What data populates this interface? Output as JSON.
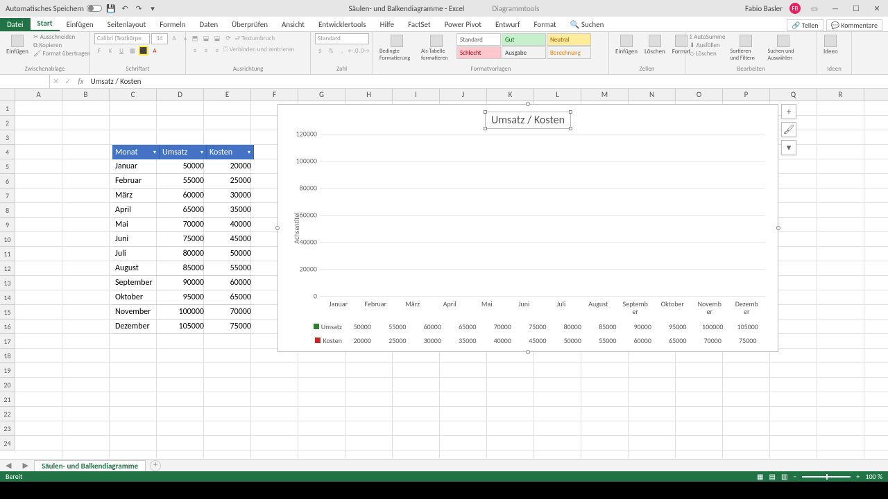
{
  "titlebar": {
    "autosave": "Automatisches Speichern",
    "doc_title": "Säulen- und Balkendiagramme - Excel",
    "tools_title": "Diagrammtools",
    "user": "Fabio Basler",
    "user_initials": "FB"
  },
  "ribbon_tabs": {
    "file": "Datei",
    "start": "Start",
    "insert": "Einfügen",
    "pagelayout": "Seitenlayout",
    "formulas": "Formeln",
    "data": "Daten",
    "review": "Überprüfen",
    "view": "Ansicht",
    "developer": "Entwicklertools",
    "help": "Hilfe",
    "factset": "FactSet",
    "powerpivot": "Power Pivot",
    "design": "Entwurf",
    "format": "Format",
    "search": "Suchen",
    "share": "Teilen",
    "comments": "Kommentare"
  },
  "ribbon": {
    "paste": "Einfügen",
    "cut": "Ausschneiden",
    "copy": "Kopieren",
    "formatpainter": "Format übertragen",
    "clipboard": "Zwischenablage",
    "fontname": "Calibri (Textkörpe",
    "fontsize": "14",
    "font": "Schriftart",
    "wrap": "Textumbruch",
    "merge": "Verbinden und zentrieren",
    "alignment": "Ausrichtung",
    "numfmt": "Standard",
    "number": "Zahl",
    "condfmt": "Bedingte Formatierung",
    "astable": "Als Tabelle formatieren",
    "s_standard": "Standard",
    "s_gut": "Gut",
    "s_neutral": "Neutral",
    "s_schlecht": "Schlecht",
    "s_ausgabe": "Ausgabe",
    "s_berechnung": "Berechnung",
    "styles": "Formatvorlagen",
    "ins": "Einfügen",
    "del": "Löschen",
    "fmt": "Format",
    "cells": "Zellen",
    "autosum": "AutoSumme",
    "fill": "Ausfüllen",
    "clear": "Löschen",
    "sort": "Sortieren und Filtern",
    "find": "Suchen und Auswählen",
    "editing": "Bearbeiten",
    "ideas": "Ideen",
    "ideas_g": "Ideen"
  },
  "formula_bar": "Umsatz / Kosten",
  "columns": [
    "A",
    "B",
    "C",
    "D",
    "E",
    "F",
    "G",
    "H",
    "I",
    "J",
    "K",
    "L",
    "M",
    "N",
    "O",
    "P",
    "Q",
    "R"
  ],
  "rows": [
    "1",
    "2",
    "3",
    "4",
    "5",
    "6",
    "7",
    "8",
    "9",
    "10",
    "11",
    "12",
    "13",
    "14",
    "15",
    "16",
    "17",
    "18",
    "19",
    "20",
    "21",
    "22",
    "23",
    "24"
  ],
  "table": {
    "h1": "Monat",
    "h2": "Umsatz",
    "h3": "Kosten",
    "rows": [
      {
        "m": "Januar",
        "u": "50000",
        "k": "20000"
      },
      {
        "m": "Februar",
        "u": "55000",
        "k": "25000"
      },
      {
        "m": "März",
        "u": "60000",
        "k": "30000"
      },
      {
        "m": "April",
        "u": "65000",
        "k": "35000"
      },
      {
        "m": "Mai",
        "u": "70000",
        "k": "40000"
      },
      {
        "m": "Juni",
        "u": "75000",
        "k": "45000"
      },
      {
        "m": "Juli",
        "u": "80000",
        "k": "50000"
      },
      {
        "m": "August",
        "u": "85000",
        "k": "55000"
      },
      {
        "m": "September",
        "u": "90000",
        "k": "60000"
      },
      {
        "m": "Oktober",
        "u": "95000",
        "k": "65000"
      },
      {
        "m": "November",
        "u": "100000",
        "k": "70000"
      },
      {
        "m": "Dezember",
        "u": "105000",
        "k": "75000"
      }
    ]
  },
  "chart_data": {
    "type": "bar",
    "title": "Umsatz / Kosten",
    "ylabel": "Achsentitel",
    "categories": [
      "Januar",
      "Februar",
      "März",
      "April",
      "Mai",
      "Juni",
      "Juli",
      "August",
      "September",
      "Oktober",
      "November",
      "Dezember"
    ],
    "cat_display": [
      "Januar",
      "Februar",
      "März",
      "April",
      "Mai",
      "Juni",
      "Juli",
      "August",
      "Septemb\ner",
      "Oktober",
      "Novemb\ner",
      "Dezemb\ner"
    ],
    "series": [
      {
        "name": "Umsatz",
        "color": "#2E7D32",
        "values": [
          50000,
          55000,
          60000,
          65000,
          70000,
          75000,
          80000,
          85000,
          90000,
          95000,
          100000,
          105000
        ]
      },
      {
        "name": "Kosten",
        "color": "#C62828",
        "values": [
          20000,
          25000,
          30000,
          35000,
          40000,
          45000,
          50000,
          55000,
          60000,
          65000,
          70000,
          75000
        ]
      }
    ],
    "ylim": [
      0,
      120000
    ],
    "yticks": [
      0,
      20000,
      40000,
      60000,
      80000,
      100000,
      120000
    ]
  },
  "sheet": "Säulen- und Balkendiagramme",
  "status": {
    "ready": "Bereit",
    "zoom": "100 %"
  }
}
